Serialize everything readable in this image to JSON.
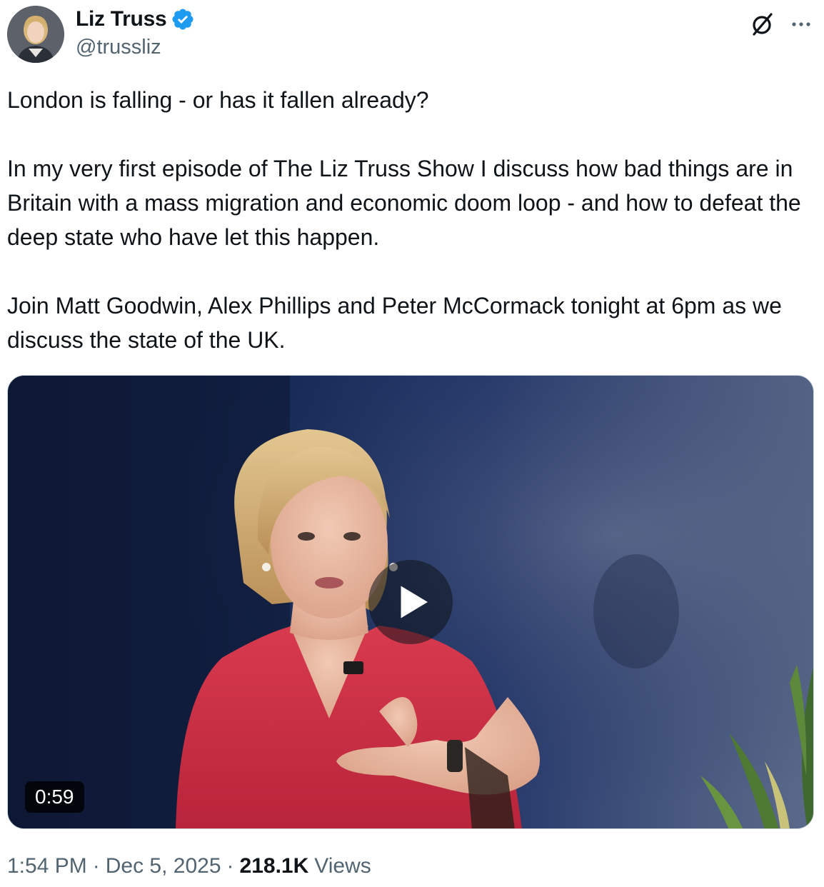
{
  "author": {
    "name": "Liz Truss",
    "handle": "@trussliz",
    "verified": true
  },
  "tweet": {
    "paragraphs": [
      "London is falling - or has it fallen already?",
      "In my very first episode of The Liz Truss Show I discuss how bad things are in Britain with a mass migration and economic doom loop  - and how to defeat the deep state who have let this happen.",
      "Join Matt Goodwin, Alex Phillips and Peter McCormack tonight at 6pm as we discuss the state of the UK."
    ]
  },
  "media": {
    "type": "video",
    "duration": "0:59"
  },
  "meta": {
    "time": "1:54 PM",
    "separator": "·",
    "date": "Dec 5, 2025",
    "views_count": "218.1K",
    "views_label": "Views"
  },
  "icons": {
    "verified": "verified-badge-icon",
    "grok": "grok-icon",
    "more": "more-options-icon",
    "play": "play-icon"
  },
  "colors": {
    "text_primary": "#0f1419",
    "text_secondary": "#536471",
    "verified_blue": "#1d9bf0",
    "border": "#cfd9de"
  }
}
